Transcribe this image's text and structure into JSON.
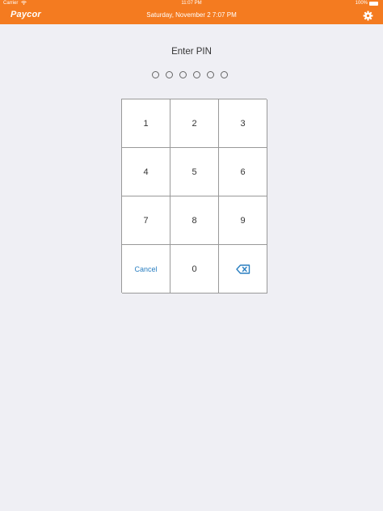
{
  "status_bar": {
    "carrier": "Carrier",
    "time": "11:07 PM",
    "battery": "100%"
  },
  "nav": {
    "logo": "Paycor",
    "datetime": "Saturday, November 2  7:07 PM",
    "settings_icon": "gear-icon"
  },
  "pin": {
    "title": "Enter PIN",
    "length": 6
  },
  "keypad": {
    "keys": [
      "1",
      "2",
      "3",
      "4",
      "5",
      "6",
      "7",
      "8",
      "9"
    ],
    "cancel_label": "Cancel",
    "zero_label": "0",
    "backspace_icon": "backspace-icon"
  },
  "colors": {
    "brand": "#f47b20",
    "background": "#efeff4",
    "accent": "#2a7fc1"
  }
}
